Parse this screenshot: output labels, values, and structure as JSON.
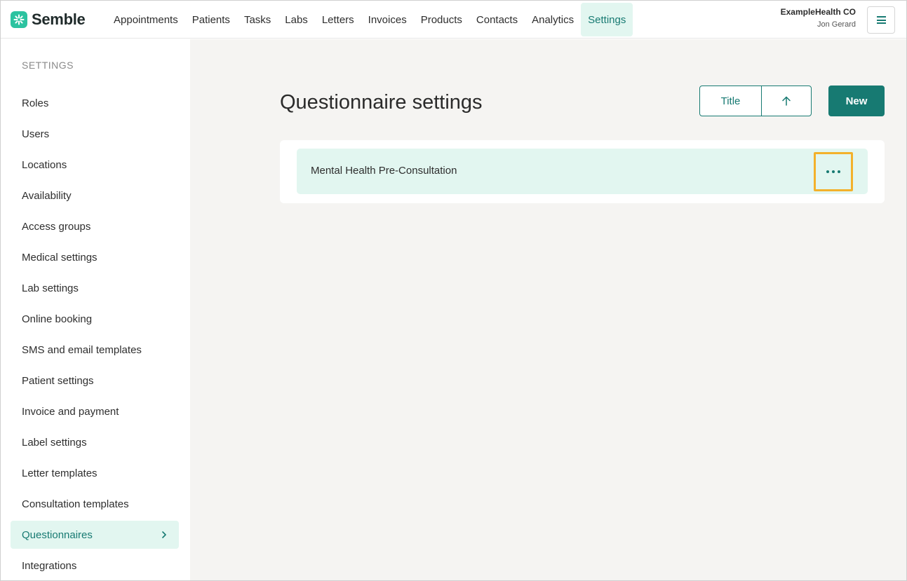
{
  "header": {
    "logo_text": "Semble",
    "nav": [
      {
        "label": "Appointments",
        "active": false
      },
      {
        "label": "Patients",
        "active": false
      },
      {
        "label": "Tasks",
        "active": false
      },
      {
        "label": "Labs",
        "active": false
      },
      {
        "label": "Letters",
        "active": false
      },
      {
        "label": "Invoices",
        "active": false
      },
      {
        "label": "Products",
        "active": false
      },
      {
        "label": "Contacts",
        "active": false
      },
      {
        "label": "Analytics",
        "active": false
      },
      {
        "label": "Settings",
        "active": true
      }
    ],
    "org_name": "ExampleHealth CO",
    "user_name": "Jon Gerard",
    "menu_icon": "hamburger-icon"
  },
  "sidebar": {
    "heading": "SETTINGS",
    "items": [
      {
        "label": "Roles"
      },
      {
        "label": "Users"
      },
      {
        "label": "Locations"
      },
      {
        "label": "Availability"
      },
      {
        "label": "Access groups"
      },
      {
        "label": "Medical settings"
      },
      {
        "label": "Lab settings"
      },
      {
        "label": "Online booking"
      },
      {
        "label": "SMS and email templates"
      },
      {
        "label": "Patient settings"
      },
      {
        "label": "Invoice and payment"
      },
      {
        "label": "Label settings"
      },
      {
        "label": "Letter templates"
      },
      {
        "label": "Consultation templates"
      },
      {
        "label": "Questionnaires",
        "active": true
      },
      {
        "label": "Integrations"
      }
    ]
  },
  "main": {
    "title": "Questionnaire settings",
    "sort": {
      "field_label": "Title",
      "direction_icon": "arrow-up-icon"
    },
    "new_label": "New",
    "questionnaires": [
      {
        "name": "Mental Health Pre-Consultation",
        "actions_icon": "more-horizontal-icon"
      }
    ]
  },
  "colors": {
    "brand": "#177a72",
    "logo": "#2cc3a0",
    "active_bg": "#e2f6f0",
    "highlight": "#f3b12b",
    "main_bg": "#f5f4f2"
  }
}
